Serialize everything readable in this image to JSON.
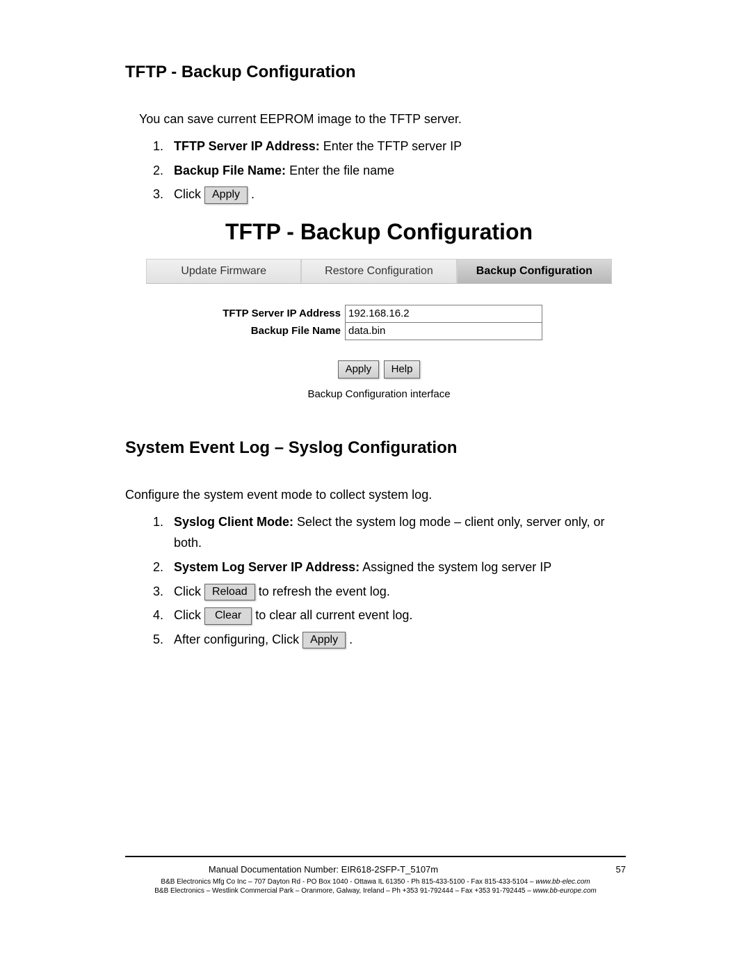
{
  "section1": {
    "heading": "TFTP - Backup Configuration",
    "intro": "You can save current EEPROM image to the TFTP server.",
    "step1_label": "TFTP Server IP Address:",
    "step1_text": " Enter the TFTP server IP",
    "step2_label": "Backup File Name:",
    "step2_text": " Enter the file name",
    "step3_pre": "Click ",
    "step3_btn": "Apply",
    "step3_post": " ."
  },
  "embedded": {
    "title": "TFTP - Backup Configuration",
    "tabs": {
      "t1": "Update Firmware",
      "t2": "Restore Configuration",
      "t3": "Backup Configuration"
    },
    "fields": {
      "ip_label": "TFTP Server IP Address",
      "ip_value": "192.168.16.2",
      "file_label": "Backup File Name",
      "file_value": "data.bin"
    },
    "buttons": {
      "apply": "Apply",
      "help": "Help"
    },
    "caption": "Backup Configuration interface"
  },
  "section2": {
    "heading": "System Event Log – Syslog Configuration",
    "intro": "Configure the system event mode to collect system log.",
    "step1_label": "Syslog Client Mode:",
    "step1_text": " Select the system log mode – client only, server only, or both.",
    "step2_label": "System Log Server IP Address:",
    "step2_text": " Assigned the system log server IP",
    "step3_pre": "Click ",
    "step3_btn": "Reload",
    "step3_post": "  to refresh the event log.",
    "step4_pre": "Click  ",
    "step4_btn": "Clear",
    "step4_post": "  to clear all current event log.",
    "step5_pre": "After configuring, Click ",
    "step5_btn": "Apply",
    "step5_post": " ."
  },
  "footer": {
    "doc_number": "Manual Documentation Number: EIR618-2SFP-T_5107m",
    "page": "57",
    "line_a_pre": "B&B Electronics Mfg Co Inc – 707 Dayton Rd - PO Box 1040 - Ottawa IL 61350 - Ph 815-433-5100 - Fax 815-433-5104 – ",
    "line_a_site": "www.bb-elec.com",
    "line_b_pre": "B&B Electronics – Westlink Commercial Park – Oranmore, Galway, Ireland – Ph +353 91-792444 – Fax +353 91-792445 – ",
    "line_b_site": "www.bb-europe.com"
  }
}
